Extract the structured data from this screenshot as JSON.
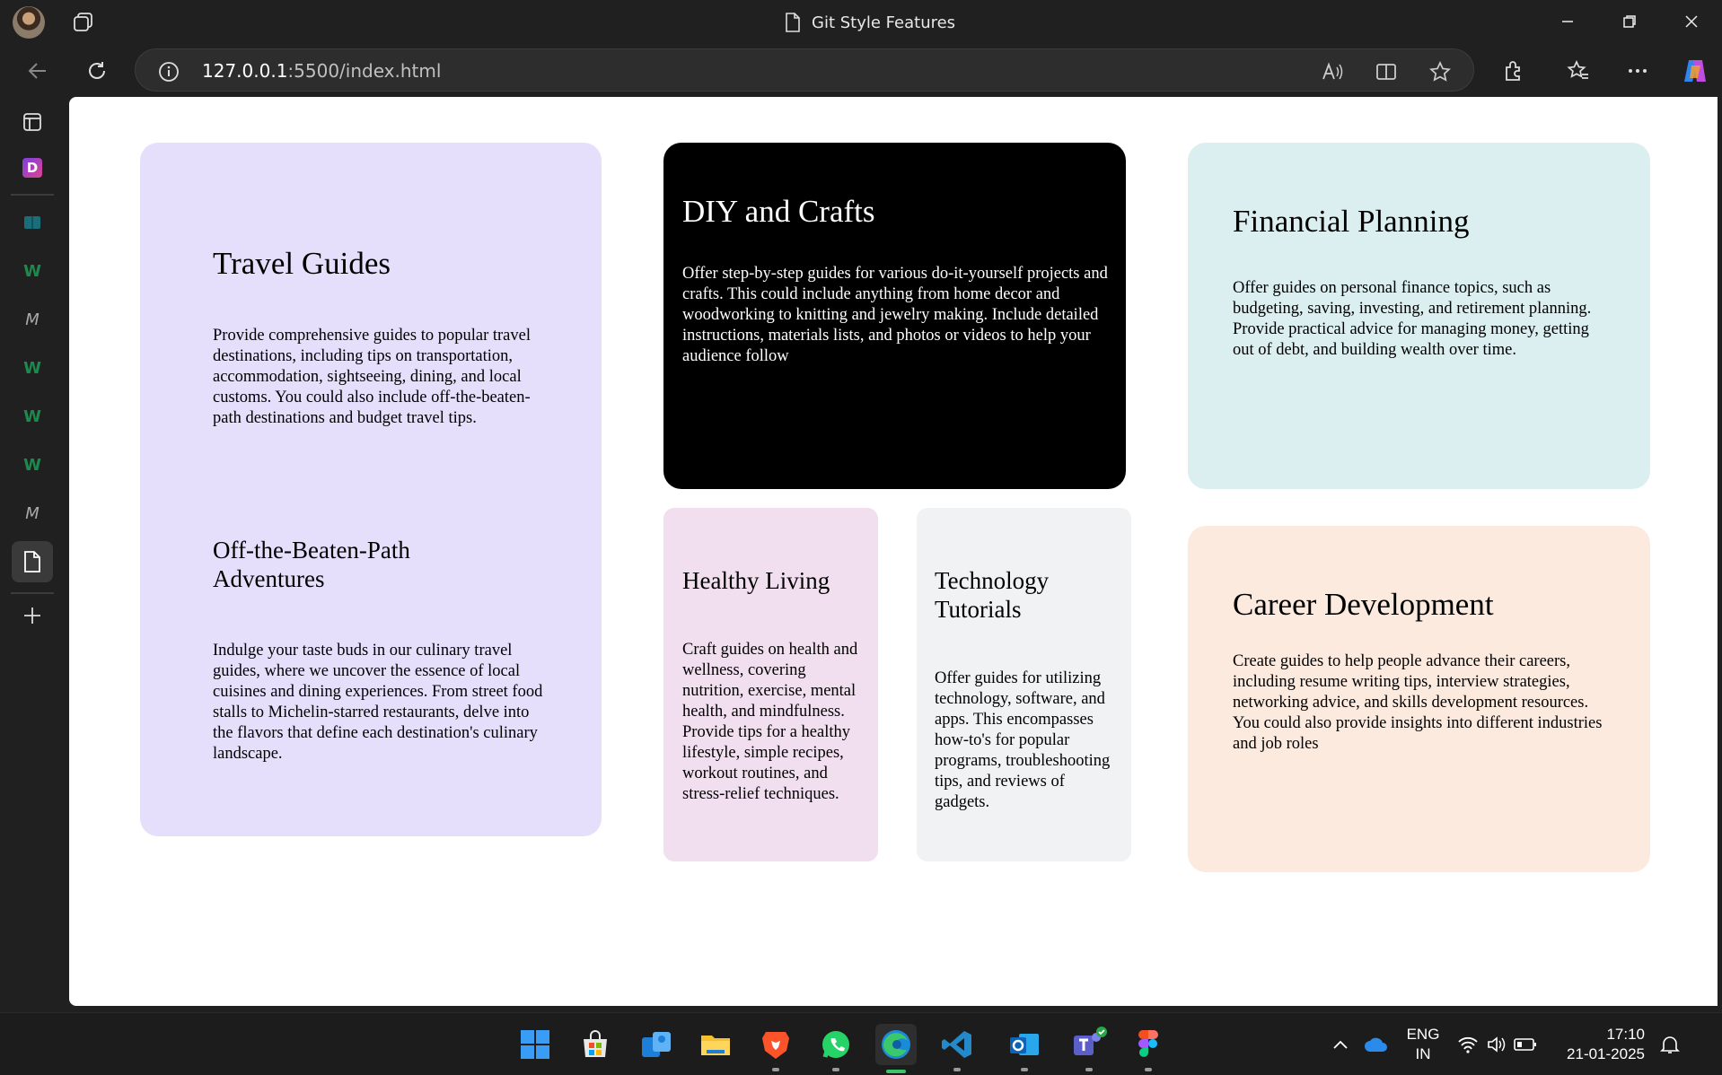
{
  "window": {
    "title": "Git Style Features"
  },
  "toolbar": {
    "url_host": "127.0.0.1",
    "url_rest": ":5500/index.html"
  },
  "sidebar": {
    "items": [
      {
        "name": "tab-actions",
        "icon": "tab-actions-icon"
      },
      {
        "name": "d-app",
        "icon": "d-app-icon",
        "glyph": "D"
      },
      {
        "name": "reading-app",
        "icon": "book-icon"
      },
      {
        "name": "w-app-1",
        "icon": "w-icon",
        "glyph": "W"
      },
      {
        "name": "m-app-1",
        "icon": "m-icon",
        "glyph": "M"
      },
      {
        "name": "w-app-2",
        "icon": "w-icon",
        "glyph": "W"
      },
      {
        "name": "w-app-3",
        "icon": "w-icon",
        "glyph": "W"
      },
      {
        "name": "w-app-4",
        "icon": "w-icon",
        "glyph": "W"
      },
      {
        "name": "m-app-2",
        "icon": "m-icon",
        "glyph": "M"
      },
      {
        "name": "page-app",
        "icon": "document-icon"
      },
      {
        "name": "add-app",
        "icon": "plus-icon"
      }
    ]
  },
  "cards": {
    "travel": {
      "heading1": "Travel Guides",
      "text1": "Provide comprehensive guides to popular travel destinations, including tips on transportation, accommodation, sightseeing, dining, and local customs. You could also include off-the-beaten-path destinations and budget travel tips.",
      "heading2": "Off-the-Beaten-Path Adventures",
      "text2": "Indulge your taste buds in our culinary travel guides, where we uncover the essence of local cuisines and dining experiences. From street food stalls to Michelin-starred restaurants, delve into the flavors that define each destination's culinary landscape."
    },
    "diy": {
      "heading": "DIY and Crafts",
      "text": "Offer step-by-step guides for various do-it-yourself projects and crafts. This could include anything from home decor and woodworking to knitting and jewelry making. Include detailed instructions, materials lists, and photos or videos to help your audience follow"
    },
    "financial": {
      "heading": "Financial Planning",
      "text": "Offer guides on personal finance topics, such as budgeting, saving, investing, and retirement planning. Provide practical advice for managing money, getting out of debt, and building wealth over time."
    },
    "health": {
      "heading": "Healthy Living",
      "text": "Craft guides on health and wellness, covering nutrition, exercise, mental health, and mindfulness. Provide tips for a healthy lifestyle, simple recipes, workout routines, and stress-relief techniques."
    },
    "tech": {
      "heading": "Technology Tutorials",
      "text": "Offer guides for utilizing technology, software, and apps. This encompasses how-to's for popular programs, troubleshooting tips, and reviews of gadgets."
    },
    "career": {
      "heading": "Career Development",
      "text": "Create guides to help people advance their careers, including resume writing tips, interview strategies, networking advice, and skills development resources. You could also provide insights into different industries and job roles"
    }
  },
  "colors": {
    "travel_bg": "#e6dffc",
    "diy_bg": "#000000",
    "financial_bg": "#dbeff0",
    "health_bg": "#f1dfef",
    "tech_bg": "#f1f2f4",
    "career_bg": "#fceadf"
  },
  "taskbar": {
    "apps": [
      "start-icon",
      "store-icon",
      "people-icon",
      "file-explorer-icon",
      "brave-icon",
      "whatsapp-icon",
      "edge-icon",
      "vscode-icon",
      "outlook-icon",
      "teams-icon",
      "figma-icon"
    ],
    "lang_line1": "ENG",
    "lang_line2": "IN",
    "time": "17:10",
    "date": "21-01-2025"
  }
}
